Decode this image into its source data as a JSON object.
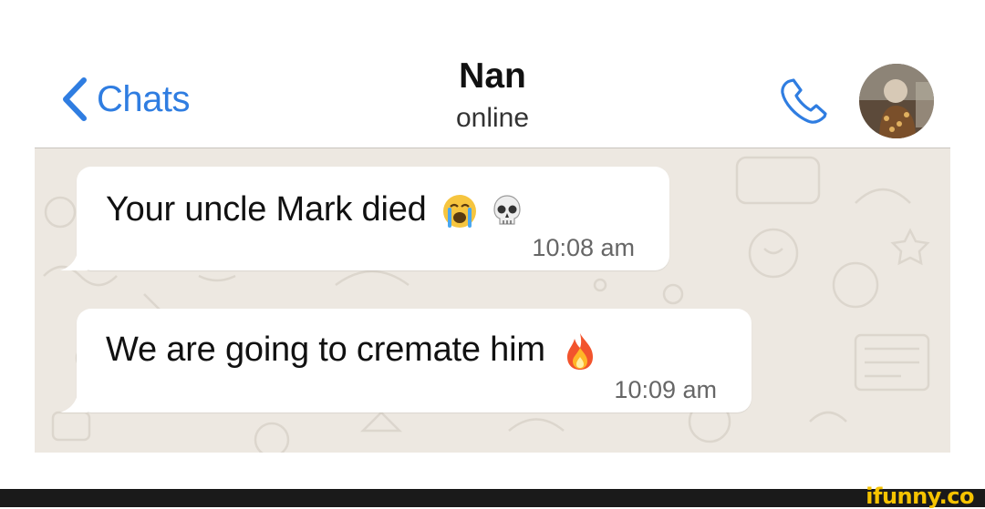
{
  "header": {
    "back_label": "Chats",
    "contact_name": "Nan",
    "status": "online"
  },
  "messages": [
    {
      "text": "Your uncle Mark died",
      "emojis": [
        "loudly-crying-face-emoji",
        "skull-emoji"
      ],
      "time": "10:08 am"
    },
    {
      "text": "We are going to cremate him",
      "emojis": [
        "fire-emoji"
      ],
      "time": "10:09 am"
    }
  ],
  "colors": {
    "accent": "#2f7de1",
    "chat_background": "#ede8e1",
    "bubble": "#ffffff",
    "footer": "#1a1a1a",
    "watermark": "#f6c300"
  },
  "watermark": "ifunny.co"
}
